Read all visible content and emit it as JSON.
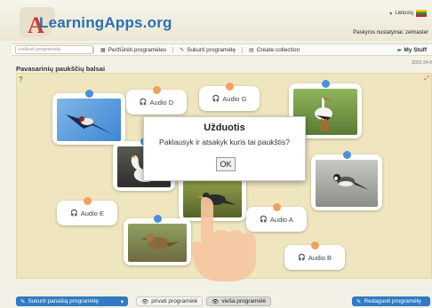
{
  "header": {
    "logo_text": "LearningApps.org",
    "logo_letter": "A",
    "language": "Lietuvių",
    "account": "Paskyros nustatymai: zelmaster"
  },
  "nav": {
    "search_placeholder": "ieškoti programėlę",
    "items": [
      {
        "icon": "grid-icon",
        "label": "Peržiūrėti programėles"
      },
      {
        "icon": "pencil-icon",
        "label": "Sukurti programėlę"
      },
      {
        "icon": "collection-icon",
        "label": "Create collection"
      }
    ],
    "my_stuff": "My Stuff"
  },
  "page": {
    "title": "Pavasarinių paukščių balsai",
    "date": "2022-24-0"
  },
  "board": {
    "audio_cards": [
      {
        "label": "Audio D"
      },
      {
        "label": "Audio G"
      },
      {
        "label": "Audio E"
      },
      {
        "label": "Audio A"
      },
      {
        "label": "Audio B"
      }
    ],
    "photo_cards": [
      {
        "name": "swallow"
      },
      {
        "name": "stork"
      },
      {
        "name": "swan"
      },
      {
        "name": "starling"
      },
      {
        "name": "wagtail"
      },
      {
        "name": "lark"
      }
    ]
  },
  "dialog": {
    "title": "Užduotis",
    "text": "Paklausyk ir atsakyk kuris tai paukštis?",
    "ok": "OK"
  },
  "footer": {
    "create_similar": "Sukurti panašią programėlę",
    "private": "privati programėlė",
    "public": "vieša programėlė",
    "edit": "Redaguoti programėlę"
  }
}
